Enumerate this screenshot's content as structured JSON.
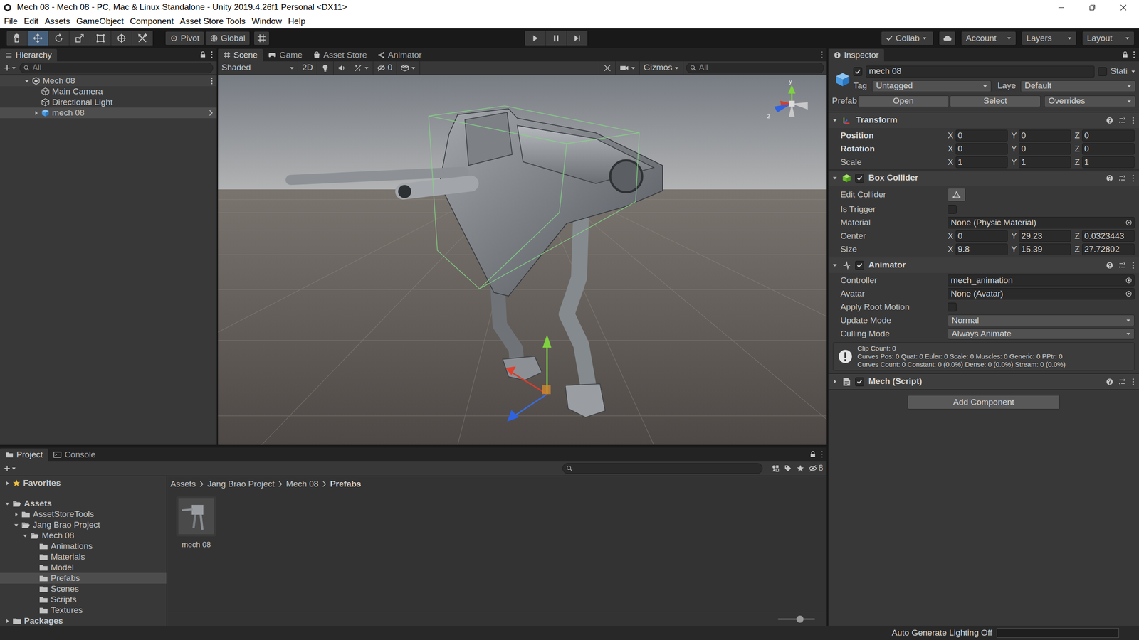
{
  "window": {
    "title": "Mech 08 - Mech 08 - PC, Mac & Linux Standalone - Unity 2019.4.26f1 Personal <DX11>"
  },
  "menu": [
    "File",
    "Edit",
    "Assets",
    "GameObject",
    "Component",
    "Asset Store Tools",
    "Window",
    "Help"
  ],
  "toolbar": {
    "tools": [
      {
        "selected": false
      },
      {
        "selected": true
      },
      {
        "selected": false
      },
      {
        "selected": false
      },
      {
        "selected": false
      },
      {
        "selected": false
      },
      {
        "selected": false
      }
    ],
    "pivot": "Pivot",
    "global": "Global",
    "collab": "Collab",
    "account": "Account",
    "layers": "Layers",
    "layout": "Layout"
  },
  "hierarchy": {
    "tab": "Hierarchy",
    "search": {
      "placeholder": "All"
    },
    "items": [
      {
        "label": "Mech 08",
        "kind": "scene",
        "expanded": true,
        "selected": false,
        "children": [
          {
            "label": "Main Camera",
            "kind": "object",
            "selected": false
          },
          {
            "label": "Directional Light",
            "kind": "object",
            "selected": false
          },
          {
            "label": "mech 08",
            "kind": "prefab",
            "expanded": false,
            "selected": true
          }
        ]
      }
    ]
  },
  "scene": {
    "tabs": [
      {
        "label": "Scene",
        "selected": true
      },
      {
        "label": "Game",
        "selected": false
      },
      {
        "label": "Asset Store",
        "selected": false
      },
      {
        "label": "Animator",
        "selected": false
      }
    ],
    "shading": "Shaded",
    "mode2d": "2D",
    "hiddenCount": "0",
    "gizmos": "Gizmos",
    "search": {
      "placeholder": "All"
    },
    "axes": {
      "y": "y",
      "z": "z"
    }
  },
  "inspector": {
    "tab": "Inspector",
    "object": {
      "name": "mech 08",
      "active": true,
      "static": {
        "label": "Stati",
        "checked": false
      }
    },
    "tag": {
      "label": "Tag",
      "value": "Untagged"
    },
    "layer": {
      "label": "Laye",
      "value": "Default"
    },
    "prefab": {
      "label": "Prefab",
      "open": "Open",
      "select": "Select",
      "overrides": "Overrides"
    },
    "axes": [
      "X",
      "Y",
      "Z"
    ],
    "components": [
      {
        "title": "Transform",
        "kind": "transform",
        "expanded": true,
        "rows": [
          {
            "kind": "vector",
            "label": "Position",
            "overridden": true,
            "values": [
              "0",
              "0",
              "0"
            ]
          },
          {
            "kind": "vector",
            "label": "Rotation",
            "overridden": true,
            "values": [
              "0",
              "0",
              "0"
            ]
          },
          {
            "kind": "vector",
            "label": "Scale",
            "overridden": false,
            "values": [
              "1",
              "1",
              "1"
            ]
          }
        ]
      },
      {
        "title": "Box Collider",
        "kind": "collider",
        "enabled": true,
        "expanded": true,
        "rows": [
          {
            "kind": "button",
            "label": "Edit Collider"
          },
          {
            "kind": "checkbox",
            "label": "Is Trigger",
            "checked": false
          },
          {
            "kind": "object",
            "label": "Material",
            "value": "None (Physic Material)"
          },
          {
            "kind": "vector",
            "label": "Center",
            "overridden": false,
            "values": [
              "0",
              "29.23",
              "0.0323443"
            ]
          },
          {
            "kind": "vector",
            "label": "Size",
            "overridden": false,
            "values": [
              "9.8",
              "15.39",
              "27.72802"
            ]
          }
        ]
      },
      {
        "title": "Animator",
        "kind": "animator",
        "enabled": true,
        "expanded": true,
        "rows": [
          {
            "kind": "object",
            "label": "Controller",
            "value": "mech_animation"
          },
          {
            "kind": "object",
            "label": "Avatar",
            "value": "None (Avatar)"
          },
          {
            "kind": "checkbox",
            "label": "Apply Root Motion",
            "checked": false
          },
          {
            "kind": "dropdown",
            "label": "Update Mode",
            "value": "Normal"
          },
          {
            "kind": "dropdown",
            "label": "Culling Mode",
            "value": "Always Animate"
          },
          {
            "kind": "info",
            "lines": [
              "Clip Count: 0",
              "Curves Pos: 0 Quat: 0 Euler: 0 Scale: 0 Muscles: 0 Generic: 0 PPtr: 0",
              "Curves Count: 0 Constant: 0 (0.0%) Dense: 0 (0.0%) Stream: 0 (0.0%)"
            ]
          }
        ]
      },
      {
        "title": "Mech (Script)",
        "kind": "script",
        "enabled": true,
        "expanded": false,
        "rows": []
      }
    ],
    "addComponent": "Add Component"
  },
  "project": {
    "tabs": [
      {
        "label": "Project",
        "selected": true
      },
      {
        "label": "Console",
        "selected": false
      }
    ],
    "hiddenCount": "8",
    "tree": [
      {
        "label": "Favorites",
        "kind": "favorites",
        "expanded": false,
        "selected": false
      },
      {
        "label": "Assets",
        "kind": "root",
        "expanded": true,
        "selected": false,
        "children": [
          {
            "label": "AssetStoreTools",
            "kind": "folder",
            "expanded": false,
            "selected": false
          },
          {
            "label": "Jang Brao Project",
            "kind": "folder",
            "expanded": true,
            "selected": false,
            "children": [
              {
                "label": "Mech 08",
                "kind": "folder",
                "expanded": true,
                "selected": false,
                "children": [
                  {
                    "label": "Animations",
                    "kind": "folder",
                    "selected": false
                  },
                  {
                    "label": "Materials",
                    "kind": "folder",
                    "selected": false
                  },
                  {
                    "label": "Model",
                    "kind": "folder",
                    "selected": false
                  },
                  {
                    "label": "Prefabs",
                    "kind": "folder",
                    "selected": true
                  },
                  {
                    "label": "Scenes",
                    "kind": "folder",
                    "selected": false
                  },
                  {
                    "label": "Scripts",
                    "kind": "folder",
                    "selected": false
                  },
                  {
                    "label": "Textures",
                    "kind": "folder",
                    "selected": false
                  }
                ]
              }
            ]
          }
        ]
      },
      {
        "label": "Packages",
        "kind": "root",
        "expanded": false,
        "selected": false
      }
    ],
    "breadcrumb": [
      "Assets",
      "Jang Brao Project",
      "Mech 08",
      "Prefabs"
    ],
    "assets": [
      {
        "label": "mech 08",
        "selected": false
      }
    ],
    "thumbnailSize": {
      "level": 0.6
    }
  },
  "statusBar": {
    "text": "Auto Generate Lighting Off"
  }
}
